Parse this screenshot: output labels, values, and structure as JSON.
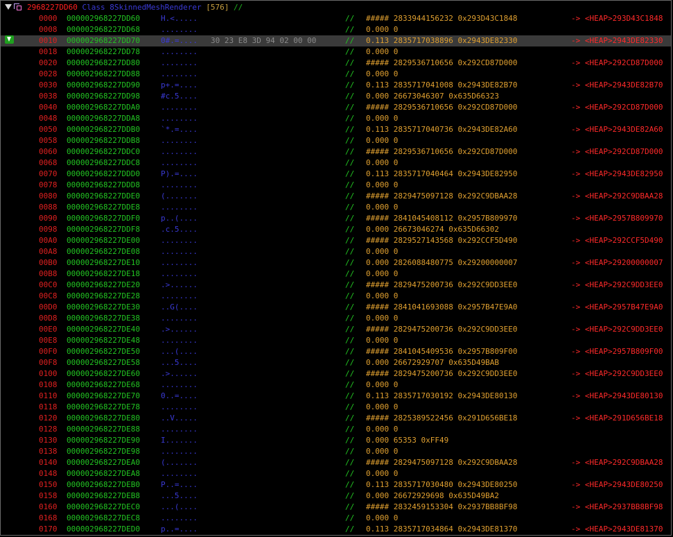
{
  "header": {
    "address": "2968227DD60",
    "class_label": "Class 8SkinnedMeshRenderer",
    "count": "[576]",
    "comment": "//"
  },
  "rows": [
    {
      "off": "0000",
      "addr": "000002968227DD60",
      "ascii": "H.<.....",
      "hex": "",
      "cm": "//",
      "val": "##### 2833944156232 0x293D43C1848",
      "ptr": "-> <HEAP>293D43C1848"
    },
    {
      "off": "0008",
      "addr": "000002968227DD68",
      "ascii": "........",
      "hex": "",
      "cm": "//",
      "val": "0.000 0",
      "ptr": ""
    },
    {
      "off": "0010",
      "addr": "000002968227DD70",
      "ascii": "0#.=....",
      "hex": "30 23 E8 3D 94 02 00 00",
      "cm": "//",
      "val": "0.113 2835717038896 0x2943DE82330",
      "ptr": "-> <HEAP>2943DE82330",
      "selected": true
    },
    {
      "off": "0018",
      "addr": "000002968227DD78",
      "ascii": "........",
      "hex": "",
      "cm": "//",
      "val": "0.000 0",
      "ptr": ""
    },
    {
      "off": "0020",
      "addr": "000002968227DD80",
      "ascii": "........",
      "hex": "",
      "cm": "//",
      "val": "##### 2829536710656 0x292CD87D000",
      "ptr": "-> <HEAP>292CD87D000"
    },
    {
      "off": "0028",
      "addr": "000002968227DD88",
      "ascii": "........",
      "hex": "",
      "cm": "//",
      "val": "0.000 0",
      "ptr": ""
    },
    {
      "off": "0030",
      "addr": "000002968227DD90",
      "ascii": "p+.=....",
      "hex": "",
      "cm": "//",
      "val": "0.113 2835717041008 0x2943DE82B70",
      "ptr": "-> <HEAP>2943DE82B70"
    },
    {
      "off": "0038",
      "addr": "000002968227DD98",
      "ascii": "#c.5....",
      "hex": "",
      "cm": "//",
      "val": "0.000 26673046307 0x635D66323",
      "ptr": ""
    },
    {
      "off": "0040",
      "addr": "000002968227DDA0",
      "ascii": "........",
      "hex": "",
      "cm": "//",
      "val": "##### 2829536710656 0x292CD87D000",
      "ptr": "-> <HEAP>292CD87D000"
    },
    {
      "off": "0048",
      "addr": "000002968227DDA8",
      "ascii": "........",
      "hex": "",
      "cm": "//",
      "val": "0.000 0",
      "ptr": ""
    },
    {
      "off": "0050",
      "addr": "000002968227DDB0",
      "ascii": "`*.=....",
      "hex": "",
      "cm": "//",
      "val": "0.113 2835717040736 0x2943DE82A60",
      "ptr": "-> <HEAP>2943DE82A60"
    },
    {
      "off": "0058",
      "addr": "000002968227DDB8",
      "ascii": "........",
      "hex": "",
      "cm": "//",
      "val": "0.000 0",
      "ptr": ""
    },
    {
      "off": "0060",
      "addr": "000002968227DDC0",
      "ascii": "........",
      "hex": "",
      "cm": "//",
      "val": "##### 2829536710656 0x292CD87D000",
      "ptr": "-> <HEAP>292CD87D000"
    },
    {
      "off": "0068",
      "addr": "000002968227DDC8",
      "ascii": "........",
      "hex": "",
      "cm": "//",
      "val": "0.000 0",
      "ptr": ""
    },
    {
      "off": "0070",
      "addr": "000002968227DDD0",
      "ascii": "P).=....",
      "hex": "",
      "cm": "//",
      "val": "0.113 2835717040464 0x2943DE82950",
      "ptr": "-> <HEAP>2943DE82950"
    },
    {
      "off": "0078",
      "addr": "000002968227DDD8",
      "ascii": "........",
      "hex": "",
      "cm": "//",
      "val": "0.000 0",
      "ptr": ""
    },
    {
      "off": "0080",
      "addr": "000002968227DDE0",
      "ascii": "(.......",
      "hex": "",
      "cm": "//",
      "val": "##### 2829475097128 0x292C9DBAA28",
      "ptr": "-> <HEAP>292C9DBAA28"
    },
    {
      "off": "0088",
      "addr": "000002968227DDE8",
      "ascii": "........",
      "hex": "",
      "cm": "//",
      "val": "0.000 0",
      "ptr": ""
    },
    {
      "off": "0090",
      "addr": "000002968227DDF0",
      "ascii": "p..(....",
      "hex": "",
      "cm": "//",
      "val": "##### 2841045408112 0x2957B809970",
      "ptr": "-> <HEAP>2957B809970"
    },
    {
      "off": "0098",
      "addr": "000002968227DDF8",
      "ascii": ".c.5....",
      "hex": "",
      "cm": "//",
      "val": "0.000 26673046274 0x635D66302",
      "ptr": ""
    },
    {
      "off": "00A0",
      "addr": "000002968227DE00",
      "ascii": "........",
      "hex": "",
      "cm": "//",
      "val": "##### 2829527143568 0x292CCF5D490",
      "ptr": "-> <HEAP>292CCF5D490"
    },
    {
      "off": "00A8",
      "addr": "000002968227DE08",
      "ascii": "........",
      "hex": "",
      "cm": "//",
      "val": "0.000 0",
      "ptr": ""
    },
    {
      "off": "00B0",
      "addr": "000002968227DE10",
      "ascii": "........",
      "hex": "",
      "cm": "//",
      "val": "0.000 2826088480775 0x29200000007",
      "ptr": "-> <HEAP>29200000007"
    },
    {
      "off": "00B8",
      "addr": "000002968227DE18",
      "ascii": "........",
      "hex": "",
      "cm": "//",
      "val": "0.000 0",
      "ptr": ""
    },
    {
      "off": "00C0",
      "addr": "000002968227DE20",
      "ascii": ".>......",
      "hex": "",
      "cm": "//",
      "val": "##### 2829475200736 0x292C9DD3EE0",
      "ptr": "-> <HEAP>292C9DD3EE0"
    },
    {
      "off": "00C8",
      "addr": "000002968227DE28",
      "ascii": "........",
      "hex": "",
      "cm": "//",
      "val": "0.000 0",
      "ptr": ""
    },
    {
      "off": "00D0",
      "addr": "000002968227DE30",
      "ascii": "..G(....",
      "hex": "",
      "cm": "//",
      "val": "##### 2841041693088 0x2957B47E9A0",
      "ptr": "-> <HEAP>2957B47E9A0"
    },
    {
      "off": "00D8",
      "addr": "000002968227DE38",
      "ascii": "........",
      "hex": "",
      "cm": "//",
      "val": "0.000 0",
      "ptr": ""
    },
    {
      "off": "00E0",
      "addr": "000002968227DE40",
      "ascii": ".>......",
      "hex": "",
      "cm": "//",
      "val": "##### 2829475200736 0x292C9DD3EE0",
      "ptr": "-> <HEAP>292C9DD3EE0"
    },
    {
      "off": "00E8",
      "addr": "000002968227DE48",
      "ascii": "........",
      "hex": "",
      "cm": "//",
      "val": "0.000 0",
      "ptr": ""
    },
    {
      "off": "00F0",
      "addr": "000002968227DE50",
      "ascii": "...(....",
      "hex": "",
      "cm": "//",
      "val": "##### 2841045409536 0x2957B809F00",
      "ptr": "-> <HEAP>2957B809F00"
    },
    {
      "off": "00F8",
      "addr": "000002968227DE58",
      "ascii": "...5....",
      "hex": "",
      "cm": "//",
      "val": "0.000 26672929707 0x635D49BAB",
      "ptr": ""
    },
    {
      "off": "0100",
      "addr": "000002968227DE60",
      "ascii": ".>......",
      "hex": "",
      "cm": "//",
      "val": "##### 2829475200736 0x292C9DD3EE0",
      "ptr": "-> <HEAP>292C9DD3EE0"
    },
    {
      "off": "0108",
      "addr": "000002968227DE68",
      "ascii": "........",
      "hex": "",
      "cm": "//",
      "val": "0.000 0",
      "ptr": ""
    },
    {
      "off": "0110",
      "addr": "000002968227DE70",
      "ascii": "0..=....",
      "hex": "",
      "cm": "//",
      "val": "0.113 2835717030192 0x2943DE80130",
      "ptr": "-> <HEAP>2943DE80130"
    },
    {
      "off": "0118",
      "addr": "000002968227DE78",
      "ascii": "........",
      "hex": "",
      "cm": "//",
      "val": "0.000 0",
      "ptr": ""
    },
    {
      "off": "0120",
      "addr": "000002968227DE80",
      "ascii": "..V.....",
      "hex": "",
      "cm": "//",
      "val": "##### 2825389522456 0x291D656BE18",
      "ptr": "-> <HEAP>291D656BE18"
    },
    {
      "off": "0128",
      "addr": "000002968227DE88",
      "ascii": "........",
      "hex": "",
      "cm": "//",
      "val": "0.000 0",
      "ptr": ""
    },
    {
      "off": "0130",
      "addr": "000002968227DE90",
      "ascii": "I.......",
      "hex": "",
      "cm": "//",
      "val": "0.000 65353 0xFF49",
      "ptr": ""
    },
    {
      "off": "0138",
      "addr": "000002968227DE98",
      "ascii": "........",
      "hex": "",
      "cm": "//",
      "val": "0.000 0",
      "ptr": ""
    },
    {
      "off": "0140",
      "addr": "000002968227DEA0",
      "ascii": "(.......",
      "hex": "",
      "cm": "//",
      "val": "##### 2829475097128 0x292C9DBAA28",
      "ptr": "-> <HEAP>292C9DBAA28"
    },
    {
      "off": "0148",
      "addr": "000002968227DEA8",
      "ascii": "........",
      "hex": "",
      "cm": "//",
      "val": "0.000 0",
      "ptr": ""
    },
    {
      "off": "0150",
      "addr": "000002968227DEB0",
      "ascii": "P..=....",
      "hex": "",
      "cm": "//",
      "val": "0.113 2835717030480 0x2943DE80250",
      "ptr": "-> <HEAP>2943DE80250"
    },
    {
      "off": "0158",
      "addr": "000002968227DEB8",
      "ascii": "...5....",
      "hex": "",
      "cm": "//",
      "val": "0.000 26672929698 0x635D49BA2",
      "ptr": ""
    },
    {
      "off": "0160",
      "addr": "000002968227DEC0",
      "ascii": "...(....",
      "hex": "",
      "cm": "//",
      "val": "##### 2832459153304 0x2937BB8BF98",
      "ptr": "-> <HEAP>2937BB8BF98"
    },
    {
      "off": "0168",
      "addr": "000002968227DEC8",
      "ascii": "........",
      "hex": "",
      "cm": "//",
      "val": "0.000 0",
      "ptr": ""
    },
    {
      "off": "0170",
      "addr": "000002968227DED0",
      "ascii": "p..=....",
      "hex": "",
      "cm": "//",
      "val": "0.113 2835717034864 0x2943DE81370",
      "ptr": "-> <HEAP>2943DE81370"
    }
  ]
}
